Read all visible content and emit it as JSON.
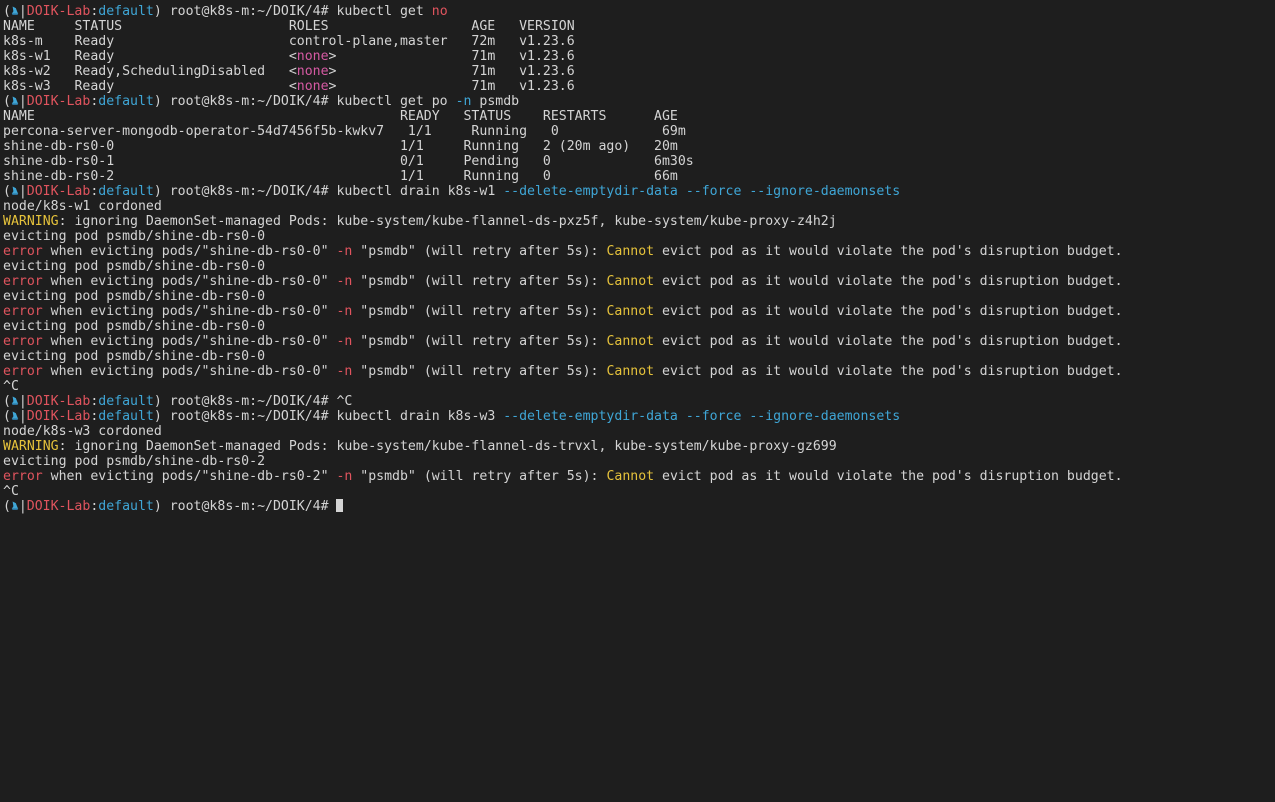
{
  "colors": {
    "background": "#1e1e1e",
    "text": "#d4d4d4",
    "red": "#e0545e",
    "cyan": "#3fa6d6",
    "yellow": "#e5c23b",
    "pink": "#d65aa3"
  },
  "terminal": {
    "lines": [
      [
        {
          "t": "(",
          "c": "default"
        },
        {
          "icon": "kubernetes-wheel-icon"
        },
        {
          "t": "|",
          "c": "default"
        },
        {
          "t": "DOIK-Lab",
          "c": "red"
        },
        {
          "t": ":",
          "c": "default"
        },
        {
          "t": "default",
          "c": "cyan"
        },
        {
          "t": ") root@k8s-m:~/DOIK/4# kubectl get ",
          "c": "default"
        },
        {
          "t": "no",
          "c": "red"
        }
      ],
      [
        {
          "t": "NAME     STATUS                     ROLES                  AGE   VERSION",
          "c": "default"
        }
      ],
      [
        {
          "t": "k8s-m    Ready                      control-plane,master   72m   v1.23.6",
          "c": "default"
        }
      ],
      [
        {
          "t": "k8s-w1   Ready                      <",
          "c": "default"
        },
        {
          "t": "none",
          "c": "pink"
        },
        {
          "t": ">                 71m   v1.23.6",
          "c": "default"
        }
      ],
      [
        {
          "t": "k8s-w2   Ready,SchedulingDisabled   <",
          "c": "default"
        },
        {
          "t": "none",
          "c": "pink"
        },
        {
          "t": ">                 71m   v1.23.6",
          "c": "default"
        }
      ],
      [
        {
          "t": "k8s-w3   Ready                      <",
          "c": "default"
        },
        {
          "t": "none",
          "c": "pink"
        },
        {
          "t": ">                 71m   v1.23.6",
          "c": "default"
        }
      ],
      [
        {
          "t": "(",
          "c": "default"
        },
        {
          "icon": "kubernetes-wheel-icon"
        },
        {
          "t": "|",
          "c": "default"
        },
        {
          "t": "DOIK-Lab",
          "c": "red"
        },
        {
          "t": ":",
          "c": "default"
        },
        {
          "t": "default",
          "c": "cyan"
        },
        {
          "t": ") root@k8s-m:~/DOIK/4# kubectl get po ",
          "c": "default"
        },
        {
          "t": "-n",
          "c": "cyan"
        },
        {
          "t": " psmdb",
          "c": "default"
        }
      ],
      [
        {
          "t": "NAME                                              READY   STATUS    RESTARTS      AGE",
          "c": "default"
        }
      ],
      [
        {
          "t": "percona-server-mongodb-operator-54d7456f5b-kwkv7   1/1     Running   0             69m",
          "c": "default"
        }
      ],
      [
        {
          "t": "shine-db-rs0-0                                    1/1     Running   2 (20m ago)   20m",
          "c": "default"
        }
      ],
      [
        {
          "t": "shine-db-rs0-1                                    0/1     Pending   0             6m30s",
          "c": "default"
        }
      ],
      [
        {
          "t": "shine-db-rs0-2                                    1/1     Running   0             66m",
          "c": "default"
        }
      ],
      [
        {
          "t": "(",
          "c": "default"
        },
        {
          "icon": "kubernetes-wheel-icon"
        },
        {
          "t": "|",
          "c": "default"
        },
        {
          "t": "DOIK-Lab",
          "c": "red"
        },
        {
          "t": ":",
          "c": "default"
        },
        {
          "t": "default",
          "c": "cyan"
        },
        {
          "t": ") root@k8s-m:~/DOIK/4# kubectl drain k8s-w1 ",
          "c": "default"
        },
        {
          "t": "--delete-emptydir-data --force --ignore-daemonsets",
          "c": "cyan"
        }
      ],
      [
        {
          "t": "node/k8s-w1 cordoned",
          "c": "default"
        }
      ],
      [
        {
          "t": "WARNING",
          "c": "yellow"
        },
        {
          "t": ": ignoring DaemonSet-managed Pods: kube-system/kube-flannel-ds-pxz5f, kube-system/kube-proxy-z4h2j",
          "c": "default"
        }
      ],
      [
        {
          "t": "evicting pod psmdb/shine-db-rs0-0",
          "c": "default"
        }
      ],
      [
        {
          "t": "error",
          "c": "red"
        },
        {
          "t": " when evicting pods/\"shine-db-rs0-0\" ",
          "c": "default"
        },
        {
          "t": "-n",
          "c": "red"
        },
        {
          "t": " \"psmdb\" (will retry after 5s): ",
          "c": "default"
        },
        {
          "t": "Cannot",
          "c": "yellow"
        },
        {
          "t": " evict pod as it would violate the pod's disruption budget.",
          "c": "default"
        }
      ],
      [
        {
          "t": "evicting pod psmdb/shine-db-rs0-0",
          "c": "default"
        }
      ],
      [
        {
          "t": "error",
          "c": "red"
        },
        {
          "t": " when evicting pods/\"shine-db-rs0-0\" ",
          "c": "default"
        },
        {
          "t": "-n",
          "c": "red"
        },
        {
          "t": " \"psmdb\" (will retry after 5s): ",
          "c": "default"
        },
        {
          "t": "Cannot",
          "c": "yellow"
        },
        {
          "t": " evict pod as it would violate the pod's disruption budget.",
          "c": "default"
        }
      ],
      [
        {
          "t": "evicting pod psmdb/shine-db-rs0-0",
          "c": "default"
        }
      ],
      [
        {
          "t": "error",
          "c": "red"
        },
        {
          "t": " when evicting pods/\"shine-db-rs0-0\" ",
          "c": "default"
        },
        {
          "t": "-n",
          "c": "red"
        },
        {
          "t": " \"psmdb\" (will retry after 5s): ",
          "c": "default"
        },
        {
          "t": "Cannot",
          "c": "yellow"
        },
        {
          "t": " evict pod as it would violate the pod's disruption budget.",
          "c": "default"
        }
      ],
      [
        {
          "t": "evicting pod psmdb/shine-db-rs0-0",
          "c": "default"
        }
      ],
      [
        {
          "t": "error",
          "c": "red"
        },
        {
          "t": " when evicting pods/\"shine-db-rs0-0\" ",
          "c": "default"
        },
        {
          "t": "-n",
          "c": "red"
        },
        {
          "t": " \"psmdb\" (will retry after 5s): ",
          "c": "default"
        },
        {
          "t": "Cannot",
          "c": "yellow"
        },
        {
          "t": " evict pod as it would violate the pod's disruption budget.",
          "c": "default"
        }
      ],
      [
        {
          "t": "evicting pod psmdb/shine-db-rs0-0",
          "c": "default"
        }
      ],
      [
        {
          "t": "error",
          "c": "red"
        },
        {
          "t": " when evicting pods/\"shine-db-rs0-0\" ",
          "c": "default"
        },
        {
          "t": "-n",
          "c": "red"
        },
        {
          "t": " \"psmdb\" (will retry after 5s): ",
          "c": "default"
        },
        {
          "t": "Cannot",
          "c": "yellow"
        },
        {
          "t": " evict pod as it would violate the pod's disruption budget.",
          "c": "default"
        }
      ],
      [
        {
          "t": "^C",
          "c": "default"
        }
      ],
      [
        {
          "t": "(",
          "c": "default"
        },
        {
          "icon": "kubernetes-wheel-icon"
        },
        {
          "t": "|",
          "c": "default"
        },
        {
          "t": "DOIK-Lab",
          "c": "red"
        },
        {
          "t": ":",
          "c": "default"
        },
        {
          "t": "default",
          "c": "cyan"
        },
        {
          "t": ") root@k8s-m:~/DOIK/4# ^C",
          "c": "default"
        }
      ],
      [
        {
          "t": "(",
          "c": "default"
        },
        {
          "icon": "kubernetes-wheel-icon"
        },
        {
          "t": "|",
          "c": "default"
        },
        {
          "t": "DOIK-Lab",
          "c": "red"
        },
        {
          "t": ":",
          "c": "default"
        },
        {
          "t": "default",
          "c": "cyan"
        },
        {
          "t": ") root@k8s-m:~/DOIK/4# kubectl drain k8s-w3 ",
          "c": "default"
        },
        {
          "t": "--delete-emptydir-data --force --ignore-daemonsets",
          "c": "cyan"
        }
      ],
      [
        {
          "t": "node/k8s-w3 cordoned",
          "c": "default"
        }
      ],
      [
        {
          "t": "WARNING",
          "c": "yellow"
        },
        {
          "t": ": ignoring DaemonSet-managed Pods: kube-system/kube-flannel-ds-trvxl, kube-system/kube-proxy-gz699",
          "c": "default"
        }
      ],
      [
        {
          "t": "evicting pod psmdb/shine-db-rs0-2",
          "c": "default"
        }
      ],
      [
        {
          "t": "error",
          "c": "red"
        },
        {
          "t": " when evicting pods/\"shine-db-rs0-2\" ",
          "c": "default"
        },
        {
          "t": "-n",
          "c": "red"
        },
        {
          "t": " \"psmdb\" (will retry after 5s): ",
          "c": "default"
        },
        {
          "t": "Cannot",
          "c": "yellow"
        },
        {
          "t": " evict pod as it would violate the pod's disruption budget.",
          "c": "default"
        }
      ],
      [
        {
          "t": "^C",
          "c": "default"
        }
      ],
      [
        {
          "t": "(",
          "c": "default"
        },
        {
          "icon": "kubernetes-wheel-icon"
        },
        {
          "t": "|",
          "c": "default"
        },
        {
          "t": "DOIK-Lab",
          "c": "red"
        },
        {
          "t": ":",
          "c": "default"
        },
        {
          "t": "default",
          "c": "cyan"
        },
        {
          "t": ") root@k8s-m:~/DOIK/4# ",
          "c": "default"
        },
        {
          "cursor": true
        }
      ]
    ]
  }
}
